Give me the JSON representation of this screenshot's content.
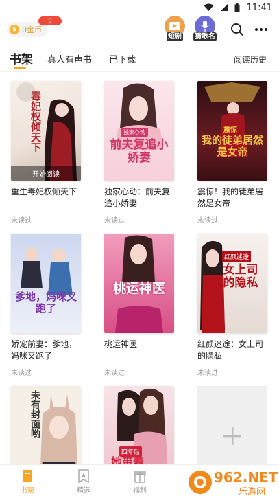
{
  "status_bar": {
    "time": "11:41"
  },
  "header": {
    "coins_label": "0金币",
    "coin_badge": "0",
    "short_drama_label": "短剧",
    "guess_song_label": "猜歌名"
  },
  "tabs": {
    "items": [
      {
        "label": "书架",
        "active": true
      },
      {
        "label": "真人有声书",
        "active": false
      },
      {
        "label": "已下载",
        "active": false
      }
    ],
    "history_label": "阅读历史"
  },
  "books": [
    {
      "title": "重生毒妃权倾天下",
      "status": "未读过",
      "cover_text": "毒妃权倾天下",
      "cover_overlay": "开始阅读",
      "bg": "#f3ebe5",
      "accent": "#b0232a"
    },
    {
      "title": "独家心动：前夫复追小娇妻",
      "status": "未读过",
      "cover_text": "前夫复追小娇妻",
      "cover_tag": "独家心动",
      "bg": "#f9dde3",
      "accent": "#d0386a"
    },
    {
      "title": "震惊！我的徒弟居然是女帝",
      "status": "未读过",
      "cover_text": "我的徒弟居然是女帝",
      "cover_tag": "震惊",
      "bg": "#5a1a1f",
      "accent": "#f1c34a"
    },
    {
      "title": "娇宠前妻：爹地，妈咪又跑了",
      "status": "未读过",
      "cover_text": "爹地，妈咪又跑了",
      "bg": "#dfe6f6",
      "accent": "#7b3aa8"
    },
    {
      "title": "桃运神医",
      "status": "未读过",
      "cover_text": "桃运神医",
      "bg": "#e67aa5",
      "accent": "#ffffff"
    },
    {
      "title": "红颜迷途：女上司的隐私",
      "status": "未读过",
      "cover_text": "女上司的隐私",
      "cover_tag": "红颜迷途",
      "bg": "#efe7e3",
      "accent": "#b3121a"
    },
    {
      "title": "",
      "status": "",
      "cover_text": "未有封面哟",
      "bg": "#f6efe6",
      "accent": "#333333"
    },
    {
      "title": "",
      "status": "",
      "cover_text": "她带着",
      "cover_tag": "四年后",
      "bg": "#f3d6dd",
      "accent": "#d2203a"
    }
  ],
  "bottom_nav": [
    {
      "label": "书架",
      "active": true
    },
    {
      "label": "精选",
      "active": false
    },
    {
      "label": "福利",
      "active": false
    }
  ],
  "watermark": {
    "brand": "962.NET",
    "sub": "乐游网"
  },
  "colors": {
    "accent": "#f5a623",
    "badge": "#f04a3a",
    "muted": "#999999"
  }
}
